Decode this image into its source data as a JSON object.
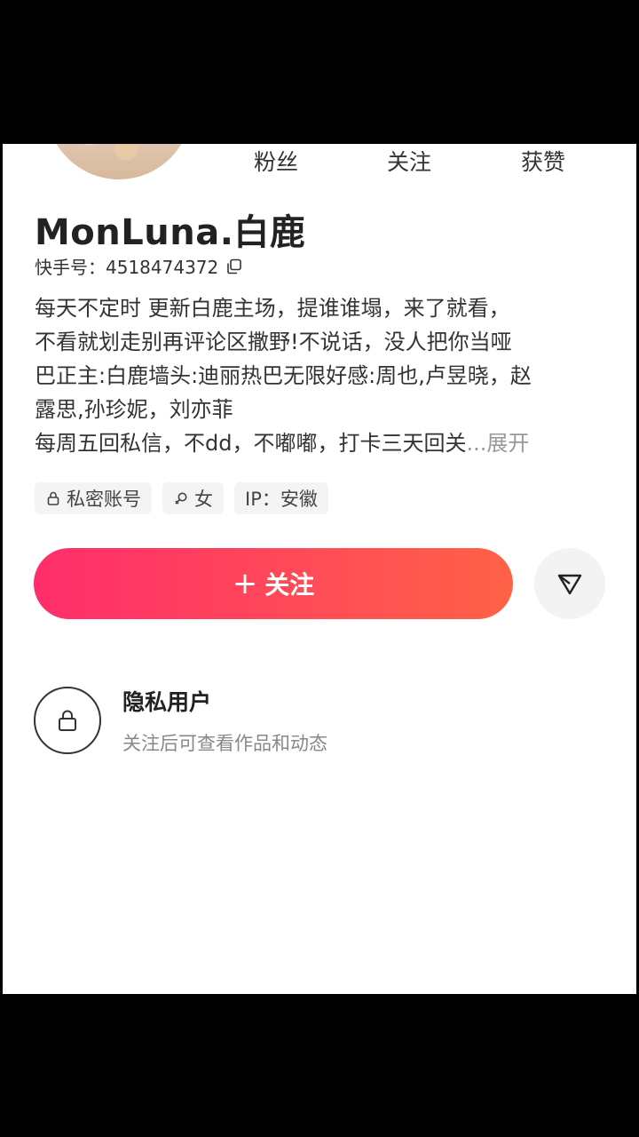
{
  "stats": {
    "fans_label": "粉丝",
    "following_label": "关注",
    "likes_label": "获赞"
  },
  "profile": {
    "name": "MonLuna.白鹿",
    "id_label": "快手号：",
    "id_value": "4518474372",
    "bio_lines": [
      "每天不定时 更新白鹿主场，提谁谁塌，来了就看，",
      "不看就划走别再评论区撒野!不说话，没人把你当哑",
      "巴正主:白鹿墙头:迪丽热巴无限好感:周也,卢昱晓，赵",
      "露思,孙珍妮，刘亦菲",
      "每周五回私信，不dd，不嘟嘟，打卡三天回关"
    ],
    "bio_more": "...展开",
    "tags": {
      "private": "私密账号",
      "gender": "女",
      "ip": "IP：安徽"
    }
  },
  "actions": {
    "follow_label": "关注",
    "follow_plus": "+"
  },
  "private_notice": {
    "title": "隐私用户",
    "subtitle": "关注后可查看作品和动态"
  },
  "colors": {
    "follow_gradient_start": "#ff2d6b",
    "follow_gradient_end": "#ff6247"
  }
}
